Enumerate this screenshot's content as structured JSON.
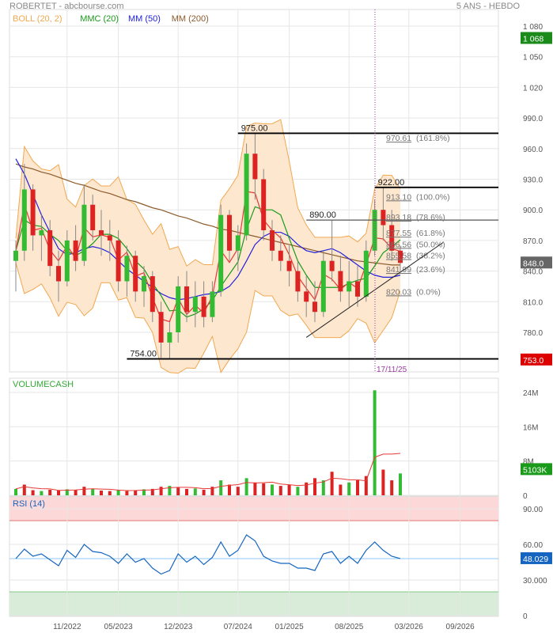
{
  "header": {
    "title": "ROBERTET - abcbourse.com",
    "period": "5 ANS - HEBDO"
  },
  "legend": [
    {
      "label": "BOLL (20, 2)",
      "color": "#f0a850"
    },
    {
      "label": "MMC (20)",
      "color": "#1a9a1a"
    },
    {
      "label": "MM (50)",
      "color": "#2222dd"
    },
    {
      "label": "MM (200)",
      "color": "#8b5a2b"
    }
  ],
  "chart_data": [
    {
      "type": "candlestick",
      "title": "ROBERTET",
      "y_ticks": [
        "1 080",
        "1 050",
        "1 020",
        "990.0",
        "960.0",
        "930.0",
        "900.0",
        "870.0",
        "840.0",
        "810.0",
        "780.0"
      ],
      "y_tick_values": [
        1080,
        1050,
        1020,
        990,
        960,
        930,
        900,
        870,
        840,
        810,
        780
      ],
      "ylim": [
        748,
        1090
      ],
      "x_ticks": [
        "11/2022",
        "05/2023",
        "12/2023",
        "07/2024",
        "01/2025",
        "08/2025",
        "03/2026",
        "09/2026"
      ],
      "x_tick_dates": [
        "2022-11",
        "2023-05",
        "2023-12",
        "2024-07",
        "2025-01",
        "2025-08",
        "2026-03",
        "2026-09"
      ],
      "months": [
        "2022-05",
        "2022-06",
        "2022-07",
        "2022-08",
        "2022-09",
        "2022-10",
        "2022-11",
        "2022-12",
        "2023-01",
        "2023-02",
        "2023-03",
        "2023-04",
        "2023-05",
        "2023-06",
        "2023-07",
        "2023-08",
        "2023-09",
        "2023-10",
        "2023-11",
        "2023-12",
        "2024-01",
        "2024-02",
        "2024-03",
        "2024-04",
        "2024-05",
        "2024-06",
        "2024-07",
        "2024-08",
        "2024-09",
        "2024-10",
        "2024-11",
        "2024-12",
        "2025-01",
        "2025-02",
        "2025-03",
        "2025-04",
        "2025-05",
        "2025-06",
        "2025-07",
        "2025-08",
        "2025-09",
        "2025-10",
        "2025-11",
        "2025-12",
        "2026-01",
        "2026-02"
      ],
      "ohlc": [
        [
          850,
          870,
          820,
          860
        ],
        [
          860,
          945,
          850,
          920
        ],
        [
          920,
          925,
          860,
          875
        ],
        [
          875,
          895,
          850,
          880
        ],
        [
          880,
          890,
          835,
          845
        ],
        [
          845,
          860,
          810,
          830
        ],
        [
          830,
          880,
          825,
          870
        ],
        [
          870,
          885,
          840,
          850
        ],
        [
          850,
          925,
          845,
          905
        ],
        [
          905,
          915,
          870,
          880
        ],
        [
          880,
          900,
          855,
          875
        ],
        [
          875,
          890,
          850,
          870
        ],
        [
          870,
          880,
          820,
          830
        ],
        [
          830,
          865,
          815,
          855
        ],
        [
          855,
          860,
          810,
          820
        ],
        [
          820,
          845,
          805,
          835
        ],
        [
          835,
          840,
          790,
          800
        ],
        [
          800,
          810,
          755,
          770
        ],
        [
          770,
          790,
          754,
          780
        ],
        [
          780,
          835,
          770,
          825
        ],
        [
          825,
          840,
          790,
          800
        ],
        [
          800,
          830,
          785,
          815
        ],
        [
          815,
          830,
          785,
          795
        ],
        [
          795,
          830,
          790,
          820
        ],
        [
          820,
          905,
          815,
          895
        ],
        [
          895,
          900,
          850,
          860
        ],
        [
          860,
          885,
          840,
          875
        ],
        [
          875,
          965,
          870,
          955
        ],
        [
          955,
          975,
          910,
          930
        ],
        [
          930,
          940,
          870,
          880
        ],
        [
          880,
          890,
          850,
          860
        ],
        [
          860,
          875,
          840,
          850
        ],
        [
          850,
          865,
          825,
          840
        ],
        [
          840,
          850,
          810,
          820
        ],
        [
          820,
          835,
          795,
          810
        ],
        [
          810,
          830,
          790,
          800
        ],
        [
          800,
          860,
          795,
          850
        ],
        [
          850,
          890,
          830,
          840
        ],
        [
          840,
          855,
          810,
          820
        ],
        [
          820,
          850,
          805,
          830
        ],
        [
          830,
          845,
          805,
          815
        ],
        [
          815,
          870,
          810,
          860
        ],
        [
          860,
          910,
          855,
          900
        ],
        [
          900,
          922,
          870,
          885
        ],
        [
          885,
          900,
          850,
          860
        ],
        [
          860,
          865,
          840,
          848
        ]
      ],
      "mm50": [
        950,
        935,
        915,
        895,
        878,
        862,
        856,
        858,
        862,
        864,
        862,
        858,
        850,
        842,
        836,
        830,
        824,
        818,
        814,
        812,
        813,
        815,
        817,
        818,
        820,
        825,
        835,
        850,
        866,
        874,
        878,
        878,
        874,
        866,
        860,
        858,
        860,
        862,
        858,
        852,
        846,
        840,
        836,
        834,
        834,
        836
      ],
      "mm200": [
        945,
        942,
        940,
        937,
        935,
        932,
        929,
        926,
        924,
        921,
        918,
        916,
        913,
        910,
        908,
        905,
        902,
        900,
        897,
        894,
        892,
        889,
        886,
        884,
        881,
        880,
        878,
        876,
        874,
        872,
        870,
        868,
        866,
        864,
        862,
        860,
        858,
        856,
        854,
        852,
        850,
        849,
        848,
        847,
        846,
        846
      ],
      "horizontal_levels": [
        {
          "label": "975.00",
          "value": 975,
          "from": "2024-07"
        },
        {
          "label": "922.00",
          "value": 922,
          "from": "2025-11"
        },
        {
          "label": "890.00",
          "value": 890,
          "from": "2025-03"
        },
        {
          "label": "754.00",
          "value": 754,
          "from": "2023-06"
        }
      ],
      "fibonacci": [
        {
          "label": "970.61",
          "pct": "(161.8%)",
          "value": 970.61
        },
        {
          "label": "913.10",
          "pct": "(100.0%)",
          "value": 913.1
        },
        {
          "label": "893.18",
          "pct": "(78.6%)",
          "value": 893.18
        },
        {
          "label": "877.55",
          "pct": "(61.8%)",
          "value": 877.55
        },
        {
          "label": "866.56",
          "pct": "(50.0%)",
          "value": 866.56
        },
        {
          "label": "855.58",
          "pct": "(38.2%)",
          "value": 855.58
        },
        {
          "label": "841.99",
          "pct": "(23.6%)",
          "value": 841.99
        },
        {
          "label": "820.03",
          "pct": "(0.0%)",
          "value": 820.03
        }
      ],
      "trendline": [
        {
          "date": "2025-03",
          "value": 775
        },
        {
          "date": "2026-07",
          "value": 868
        }
      ],
      "marker": {
        "label": "17/11/25",
        "date": "2025-11",
        "color": "#9a3aa0"
      },
      "price_tags": [
        {
          "label": "1 068",
          "value": 1068,
          "color": "#1a8a1a"
        },
        {
          "label": "848.0",
          "value": 848,
          "color": "#666666"
        },
        {
          "label": "753.0",
          "value": 753,
          "color": "#dd0000"
        }
      ]
    },
    {
      "type": "bar",
      "title": "VOLUMECASH",
      "y_ticks": [
        "24M",
        "16M",
        "8M",
        "0"
      ],
      "y_tick_values": [
        24,
        16,
        8,
        0
      ],
      "ylim": [
        0,
        27
      ],
      "unit": "M",
      "values": [
        1.5,
        2.5,
        1.2,
        1.0,
        1.3,
        1.1,
        1.4,
        1.2,
        2.0,
        1.5,
        1.1,
        1.0,
        1.3,
        1.0,
        1.2,
        1.4,
        1.5,
        2.0,
        2.2,
        1.8,
        1.5,
        1.6,
        1.3,
        2.0,
        3.5,
        2.5,
        2.0,
        4.0,
        3.0,
        2.8,
        2.5,
        2.2,
        2.4,
        2.0,
        3.0,
        4.0,
        3.5,
        5.5,
        2.5,
        3.0,
        3.5,
        4.5,
        24.5,
        6.0,
        3.5,
        5.1
      ],
      "last_tag": {
        "label": "5103K",
        "color": "#1a9a1a"
      }
    },
    {
      "type": "line",
      "title": "RSI (14)",
      "y_ticks": [
        "90.00",
        "60.00",
        "30.000",
        "0"
      ],
      "y_tick_values": [
        90,
        60,
        30,
        0
      ],
      "ylim": [
        0,
        100
      ],
      "overbought": 80,
      "oversold": 20,
      "values": [
        48,
        56,
        50,
        52,
        47,
        42,
        55,
        49,
        60,
        54,
        53,
        50,
        44,
        52,
        45,
        48,
        40,
        35,
        38,
        52,
        45,
        50,
        43,
        49,
        62,
        50,
        55,
        68,
        63,
        50,
        46,
        44,
        44,
        40,
        40,
        38,
        52,
        54,
        44,
        50,
        44,
        55,
        62,
        55,
        50,
        48.029
      ],
      "last_tag": {
        "label": "48.029",
        "color": "#1565c0"
      }
    }
  ]
}
